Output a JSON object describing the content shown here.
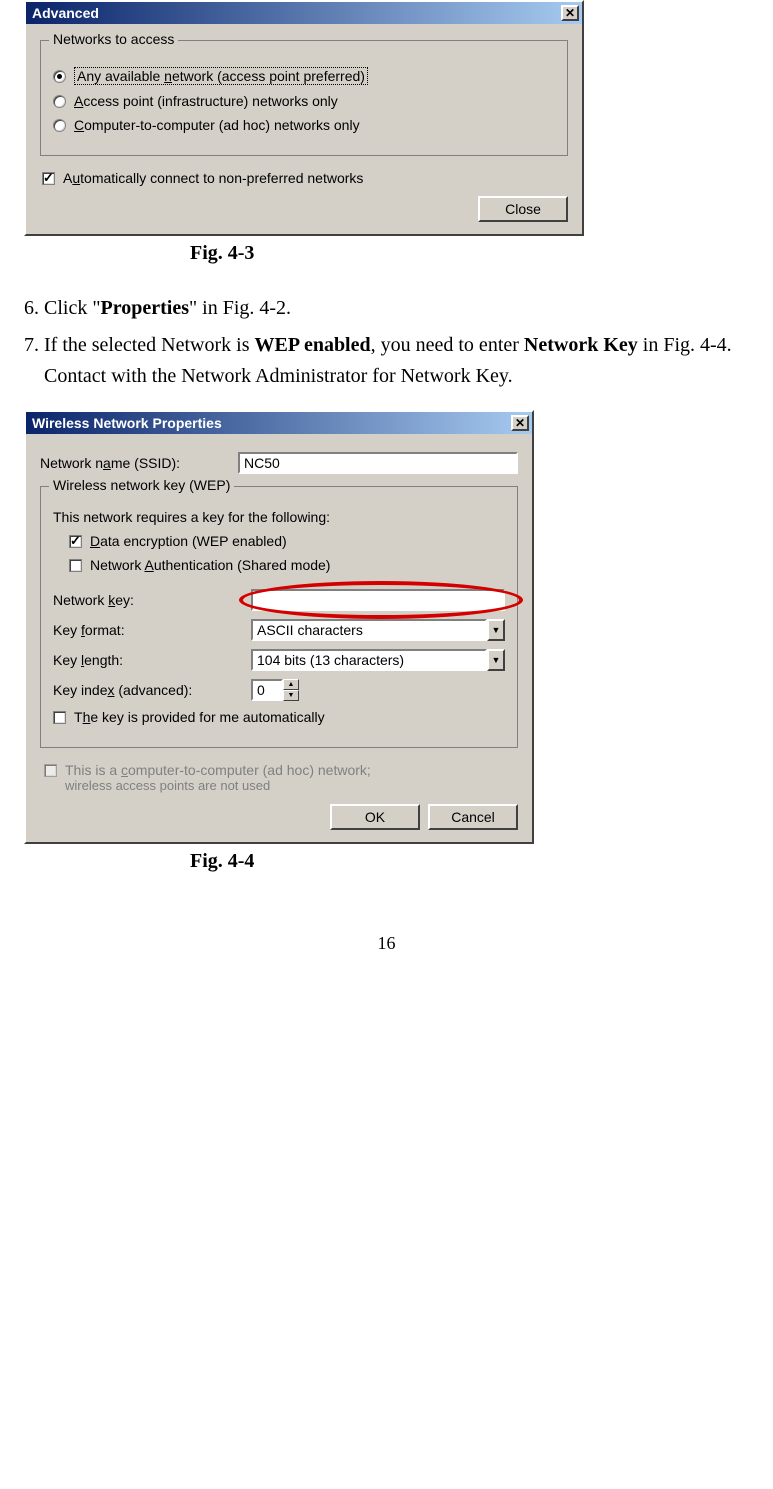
{
  "dialog1": {
    "title": "Advanced",
    "group_title": "Networks to access",
    "radio1": "Any available network (access point preferred)",
    "radio2": "Access point (infrastructure) networks only",
    "radio3": "Computer-to-computer (ad hoc) networks only",
    "auto_connect": "Automatically connect to non-preferred networks",
    "close_btn": "Close"
  },
  "caption1": "Fig. 4-3",
  "step6_a": "Click \"",
  "step6_b": "Properties",
  "step6_c": "\" in Fig. 4-2.",
  "step7_a": "If the selected Network is ",
  "step7_b": "WEP enabled",
  "step7_c": ", you need to enter ",
  "step7_d": "Network Key",
  "step7_e": " in Fig. 4-4. Contact with the Network Administrator for Network Key.",
  "dialog2": {
    "title": "Wireless Network Properties",
    "ssid_label": "Network name (SSID):",
    "ssid_value": "NC50",
    "wep_group": "Wireless network key (WEP)",
    "wep_intro": "This network requires a key for the following:",
    "data_enc": "Data encryption (WEP enabled)",
    "net_auth": "Network Authentication (Shared mode)",
    "net_key_label": "Network key:",
    "net_key_value": "",
    "key_format_label": "Key format:",
    "key_format_value": "ASCII characters",
    "key_length_label": "Key length:",
    "key_length_value": "104 bits (13 characters)",
    "key_index_label": "Key index (advanced):",
    "key_index_value": "0",
    "auto_key": "The key is provided for me automatically",
    "adhoc_line1": "This is a computer-to-computer (ad hoc) network;",
    "adhoc_line2": "wireless access points are not used",
    "ok_btn": "OK",
    "cancel_btn": "Cancel"
  },
  "caption2": "Fig. 4-4",
  "page_number": "16"
}
